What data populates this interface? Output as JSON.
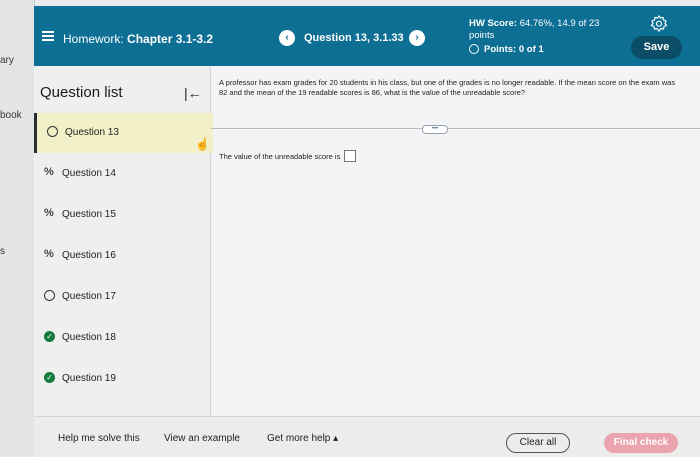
{
  "left_strip": {
    "items": [
      "ary",
      "book",
      "s"
    ]
  },
  "header": {
    "title_prefix": "Homework:",
    "title_chapter": "Chapter 3.1-3.2",
    "question": "Question 13, 3.1.33",
    "prev_glyph": "‹",
    "next_glyph": "›",
    "hw_score_label": "HW Score:",
    "hw_score_value": "64.76%, 14.9 of 23",
    "hw_score_unit": "points",
    "points_label": "Points:",
    "points_value": "0 of 1",
    "save_label": "Save",
    "brand_color": "#0d6f94"
  },
  "sidebar": {
    "heading": "Question list",
    "collapse_glyph": "|←",
    "items": [
      {
        "label": "Question 13",
        "status": "unanswered",
        "active": true
      },
      {
        "label": "Question 14",
        "status": "partial"
      },
      {
        "label": "Question 15",
        "status": "partial"
      },
      {
        "label": "Question 16",
        "status": "partial"
      },
      {
        "label": "Question 17",
        "status": "unanswered"
      },
      {
        "label": "Question 18",
        "status": "correct"
      },
      {
        "label": "Question 19",
        "status": "correct"
      }
    ]
  },
  "question": {
    "text": "A professor has exam grades for 20 students in his class, but one of the grades is no longer readable. If the mean score on the exam was 82 and the mean of the 19 readable scores is 86, what is the value of the unreadable score?",
    "expand_glyph": "•••",
    "answer_prompt": "The value of the unreadable score is",
    "answer_value": ""
  },
  "footer": {
    "help": "Help me solve this",
    "example": "View an example",
    "more_help": "Get more help",
    "more_help_glyph": "▴",
    "clear": "Clear all",
    "final": "Final check"
  }
}
